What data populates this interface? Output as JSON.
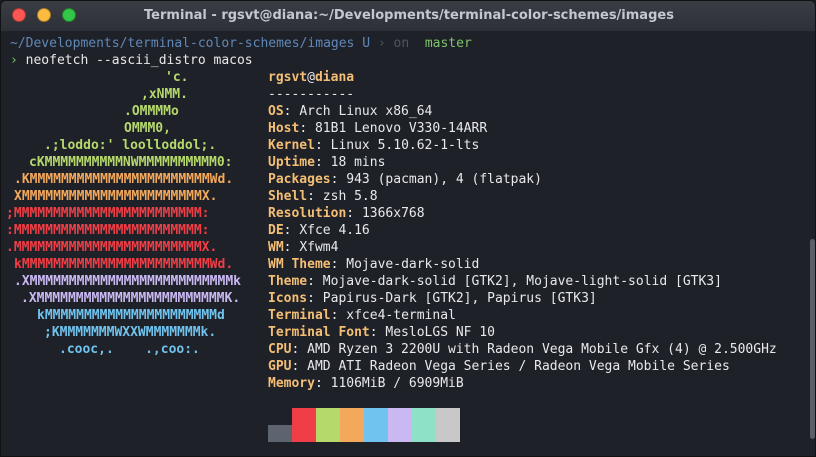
{
  "window": {
    "title": "Terminal - rgsvt@diana:~/Developments/terminal-color-schemes/images"
  },
  "prompt": {
    "path": "~/Developments/terminal-color-schemes/images",
    "u": "U",
    "sep1": "›",
    "on": "on",
    "branch_icon": "",
    "branch": "master",
    "arrow": "›",
    "command": "neofetch --ascii_distro macos"
  },
  "logo": [
    {
      "text": "'c.",
      "color": "#b5d96b"
    },
    {
      "text": ",xNMM.",
      "color": "#b5d96b"
    },
    {
      "text": ".OMMMMo",
      "color": "#b5d96b"
    },
    {
      "text": "OMMM0,",
      "color": "#b5d96b"
    },
    {
      "text": ".;loddo:' loolloddol;.",
      "color": "#b5d96b"
    },
    {
      "text": "cKMMMMMMMMMMNWMMMMMMMMMM0:",
      "color": "#b5d96b"
    },
    {
      "text": ".KMMMMMMMMMMMMMMMMMMMMMMMWd.",
      "color": "#f3a95c"
    },
    {
      "text": "XMMMMMMMMMMMMMMMMMMMMMMMX.",
      "color": "#f3a95c"
    },
    {
      "text": ";MMMMMMMMMMMMMMMMMMMMMMMM:",
      "color": "#ef3e46"
    },
    {
      "text": ":MMMMMMMMMMMMMMMMMMMMMMMM:",
      "color": "#ef3e46"
    },
    {
      "text": ".MMMMMMMMMMMMMMMMMMMMMMMMX.",
      "color": "#ef3e46"
    },
    {
      "text": "kMMMMMMMMMMMMMMMMMMMMMMMMWd.",
      "color": "#ef3e46"
    },
    {
      "text": ".XMMMMMMMMMMMMMMMMMMMMMMMMMMk",
      "color": "#c9b8f2"
    },
    {
      "text": ".XMMMMMMMMMMMMMMMMMMMMMMMMK.",
      "color": "#c9b8f2"
    },
    {
      "text": "kMMMMMMMMMMMMMMMMMMMMMMd",
      "color": "#6fc3ee"
    },
    {
      "text": ";KMMMMMMMWXXWMMMMMMMk.",
      "color": "#6fc3ee"
    },
    {
      "text": ".cooc,.    .,coo:.",
      "color": "#6fc3ee"
    }
  ],
  "header": {
    "user": "rgsvt",
    "at": "@",
    "host": "diana",
    "underline": "-----------"
  },
  "info": [
    {
      "key": "OS",
      "value": "Arch Linux x86_64"
    },
    {
      "key": "Host",
      "value": "81B1 Lenovo V330-14ARR"
    },
    {
      "key": "Kernel",
      "value": "Linux 5.10.62-1-lts"
    },
    {
      "key": "Uptime",
      "value": "18 mins"
    },
    {
      "key": "Packages",
      "value": "943 (pacman), 4 (flatpak)"
    },
    {
      "key": "Shell",
      "value": "zsh 5.8"
    },
    {
      "key": "Resolution",
      "value": "1366x768"
    },
    {
      "key": "DE",
      "value": "Xfce 4.16"
    },
    {
      "key": "WM",
      "value": "Xfwm4"
    },
    {
      "key": "WM Theme",
      "value": "Mojave-dark-solid"
    },
    {
      "key": "Theme",
      "value": "Mojave-dark-solid [GTK2], Mojave-light-solid [GTK3]"
    },
    {
      "key": "Icons",
      "value": "Papirus-Dark [GTK2], Papirus [GTK3]"
    },
    {
      "key": "Terminal",
      "value": "xfce4-terminal"
    },
    {
      "key": "Terminal Font",
      "value": "MesloLGS NF 10"
    },
    {
      "key": "CPU",
      "value": "AMD Ryzen 3 2200U with Radeon Vega Mobile Gfx (4) @ 2.500GHz"
    },
    {
      "key": "GPU",
      "value": "AMD ATI Radeon Vega Series / Radeon Vega Mobile Series"
    },
    {
      "key": "Memory",
      "value": "1106MiB / 6909MiB"
    }
  ],
  "palette": [
    "#5d6470",
    "#ef3e46",
    "#b5d96b",
    "#f3a95c",
    "#6fc3ee",
    "#c9b8f2",
    "#8ee0c7",
    "#c8c8c8"
  ]
}
